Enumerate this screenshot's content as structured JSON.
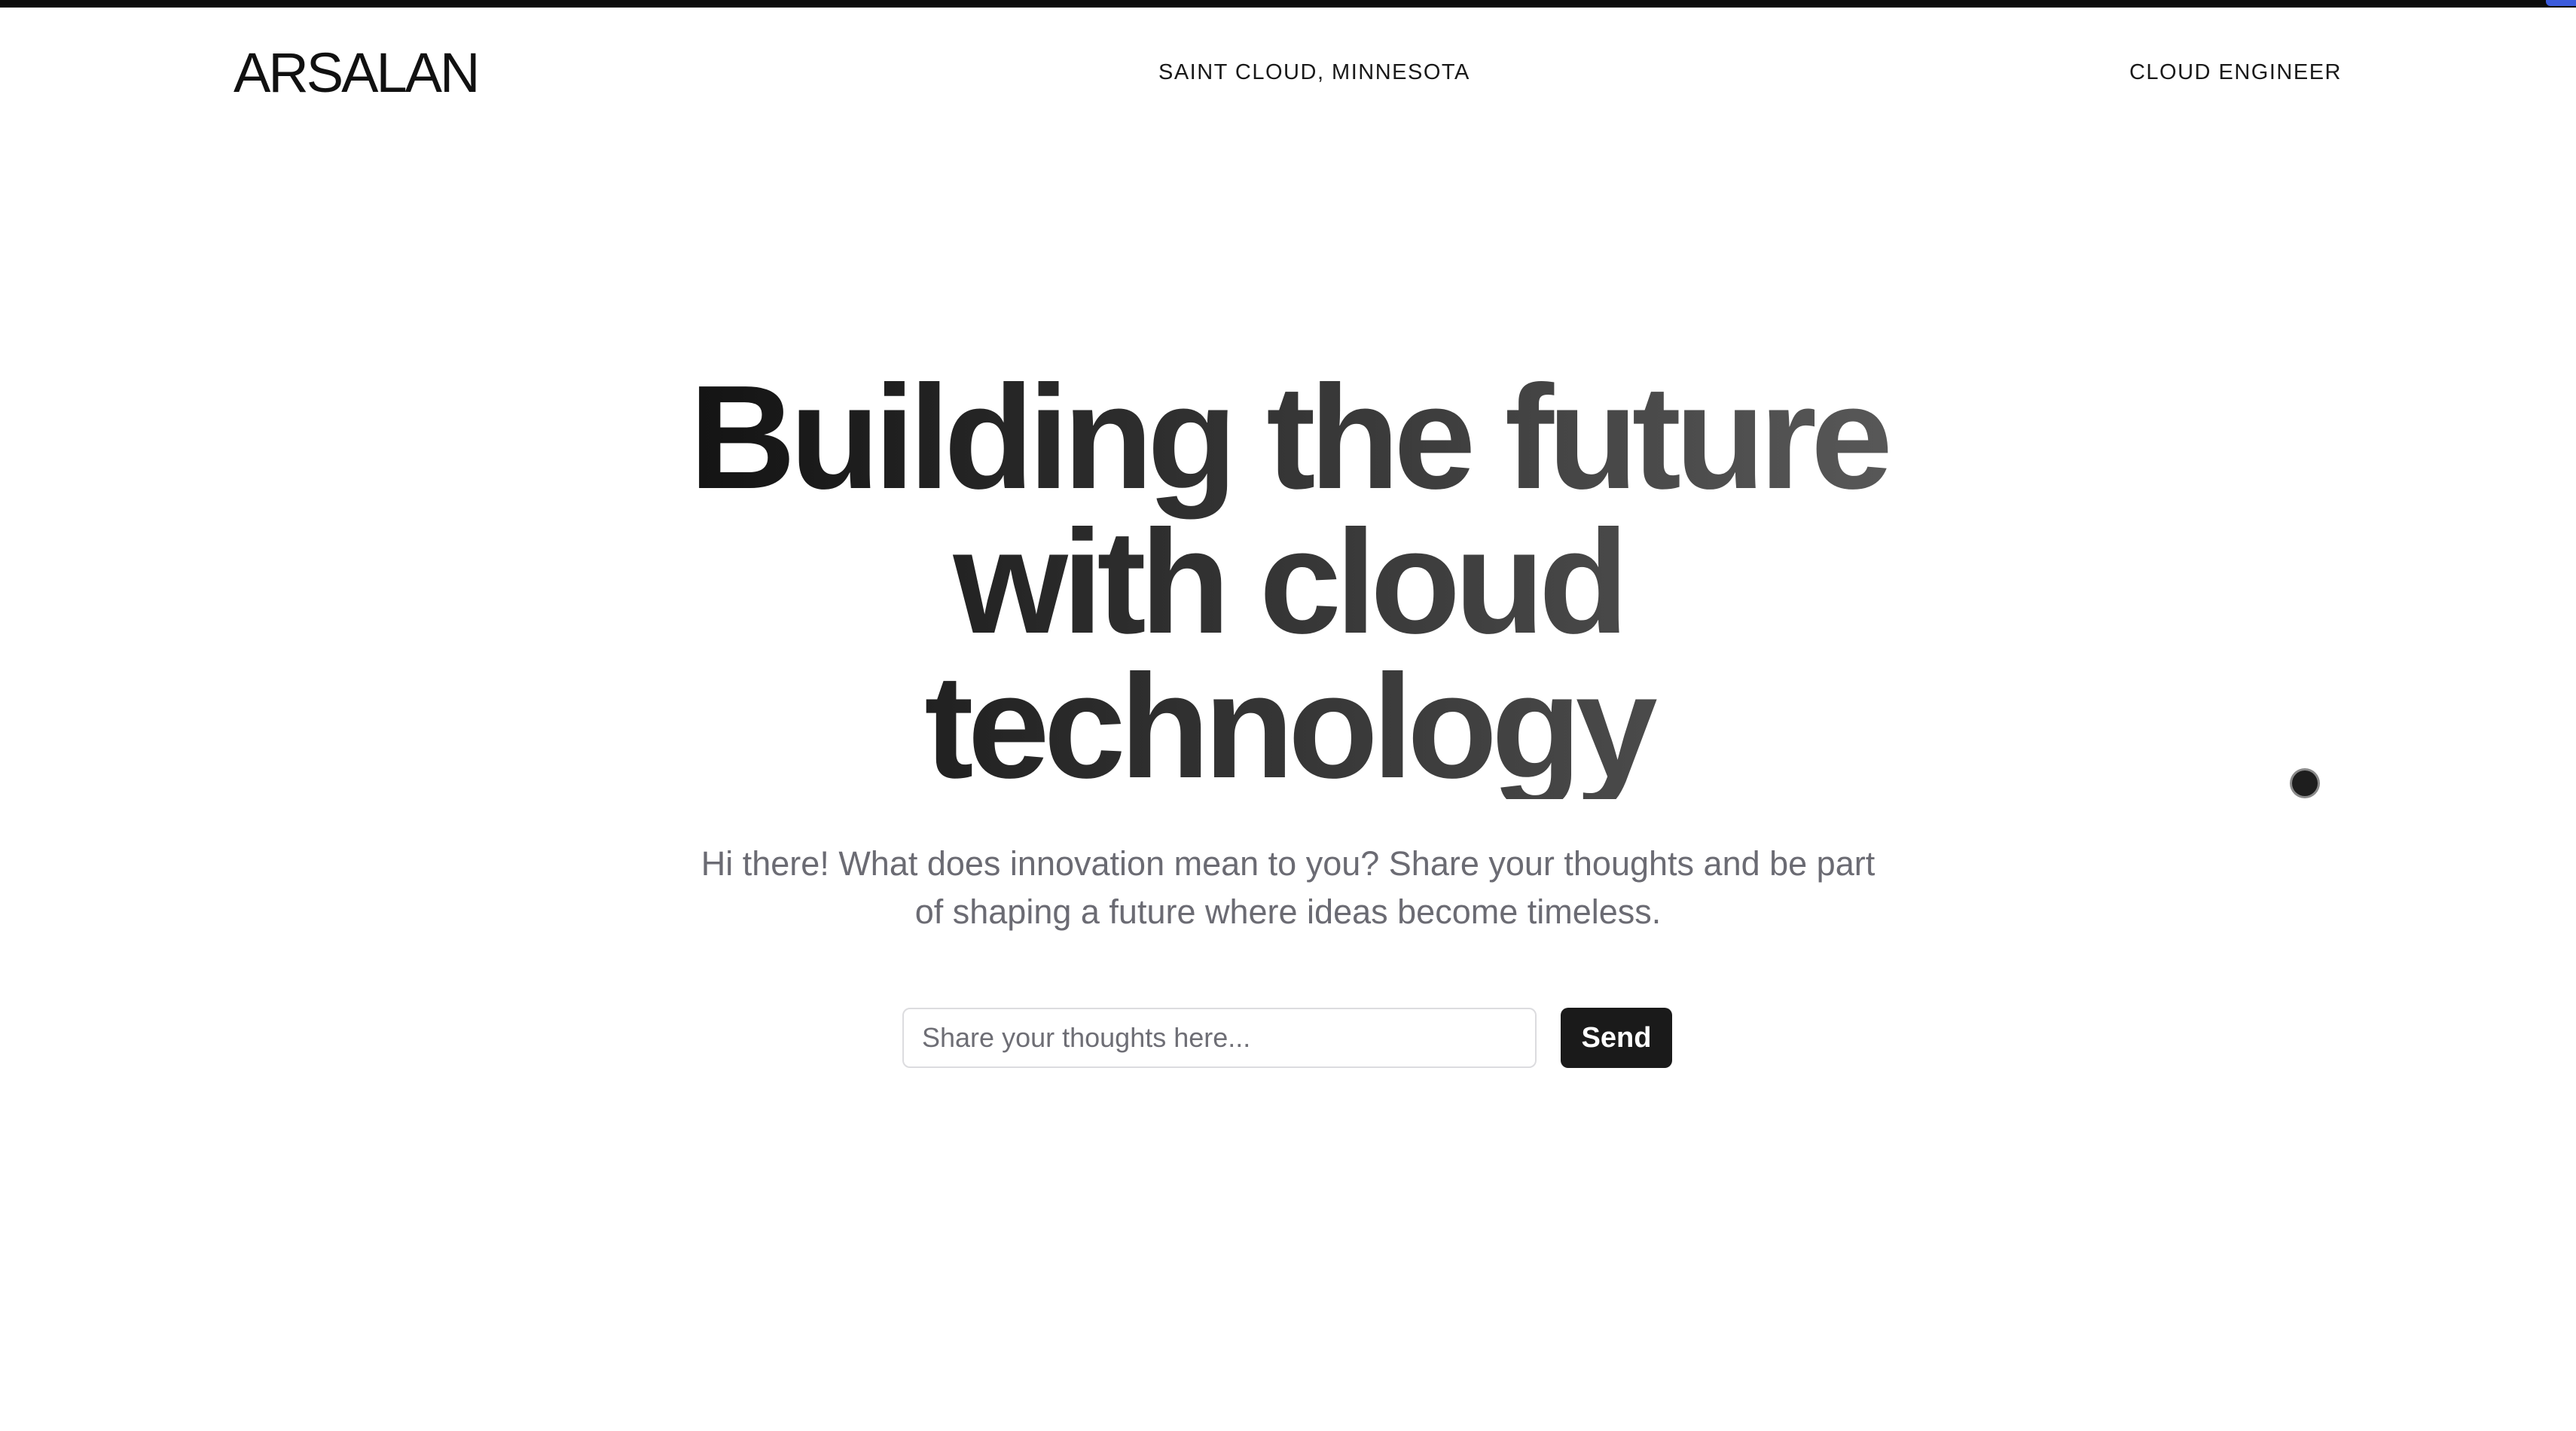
{
  "header": {
    "brand": "ARSALAN",
    "location": "SAINT CLOUD, MINNESOTA",
    "role": "CLOUD ENGINEER"
  },
  "hero": {
    "title_lines": [
      "Building the future",
      "with cloud",
      "technology"
    ],
    "subtitle": "Hi there! What does innovation mean to you? Share your thoughts and be part of shaping a future where ideas become timeless."
  },
  "form": {
    "input_placeholder": "Share your thoughts here...",
    "input_value": "",
    "send_label": "Send"
  },
  "colors": {
    "accent": "#1a1a1a",
    "subtitle_text": "#6b6b73",
    "top_bar": "#0b0b0b"
  }
}
